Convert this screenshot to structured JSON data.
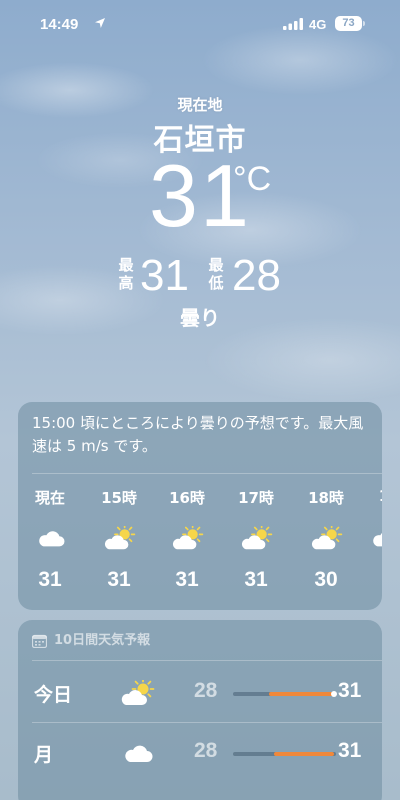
{
  "status_bar": {
    "time": "14:49",
    "network": "4G",
    "battery": "73"
  },
  "hero": {
    "location_label": "現在地",
    "city": "石垣市",
    "temperature": "31",
    "unit": "°C",
    "high_label": "最高",
    "high": "31",
    "low_label": "最低",
    "low": "28",
    "condition": "曇り"
  },
  "hourly": {
    "summary": "15:00 頃にところにより曇りの予想です。最大風速は 5 m/s です。",
    "items": [
      {
        "label": "現在",
        "icon": "cloud-icon",
        "temp": "31"
      },
      {
        "label": "15時",
        "icon": "partly-sunny-icon",
        "temp": "31"
      },
      {
        "label": "16時",
        "icon": "partly-sunny-icon",
        "temp": "31"
      },
      {
        "label": "17時",
        "icon": "partly-sunny-icon",
        "temp": "31"
      },
      {
        "label": "18時",
        "icon": "partly-sunny-icon",
        "temp": "30"
      },
      {
        "label": "1",
        "icon": "cloud-icon",
        "temp": ""
      }
    ]
  },
  "daily": {
    "title": "10日間天気予報",
    "days": [
      {
        "name": "今日",
        "icon": "partly-sunny-icon",
        "low": "28",
        "high": "31",
        "bar_start": 0.35,
        "bar_end": 1.0,
        "current_marker": 0.98
      },
      {
        "name": "月",
        "icon": "cloud-icon",
        "low": "28",
        "high": "31",
        "bar_start": 0.4,
        "bar_end": 0.98
      }
    ]
  },
  "colors": {
    "bar_orange": "#f0883a",
    "card_bg": "#6e8ca0"
  }
}
